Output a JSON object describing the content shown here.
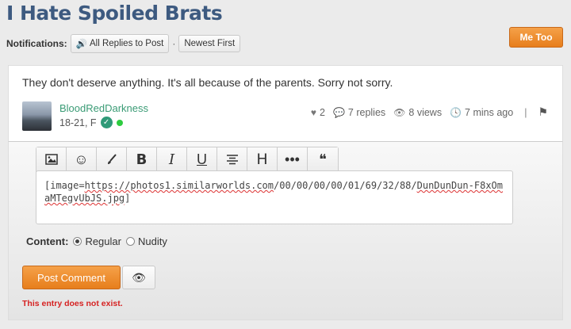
{
  "page": {
    "title": "I Hate Spoiled Brats"
  },
  "notifications": {
    "label": "Notifications:",
    "all_replies": "All Replies to Post",
    "separator": "·",
    "newest_first": "Newest First"
  },
  "me_too": "Me Too",
  "post": {
    "text": "They don't deserve anything. It's all because of the parents. Sorry not sorry.",
    "author": {
      "name": "BloodRedDarkness",
      "meta": "18-21, F"
    },
    "stats": {
      "likes": "2",
      "replies": "7 replies",
      "views": "8 views",
      "time": "7 mins ago",
      "divider": "|"
    }
  },
  "editor": {
    "toolbar": [
      "image-icon",
      "smiley-icon",
      "brush-icon",
      "bold-icon",
      "italic-icon",
      "underline-icon",
      "align-icon",
      "heading-icon",
      "more-icon",
      "quote-icon"
    ],
    "prefix": "[image=",
    "url_part1": "https://photos1.similarworlds.com",
    "url_part2": "/00/00/00/00/01/69/32/88/",
    "url_part3": "DunDunDun-F8xOmaMTegvUbJS.jpg",
    "suffix": "]"
  },
  "content_option": {
    "label": "Content:",
    "options": [
      "Regular",
      "Nudity"
    ],
    "selected": "Regular"
  },
  "actions": {
    "post_comment": "Post Comment"
  },
  "error": "This entry does not exist.",
  "colors": {
    "accent": "#e77e1c",
    "title": "#3d5a80",
    "username": "#3a9b75",
    "error": "#d62222"
  }
}
